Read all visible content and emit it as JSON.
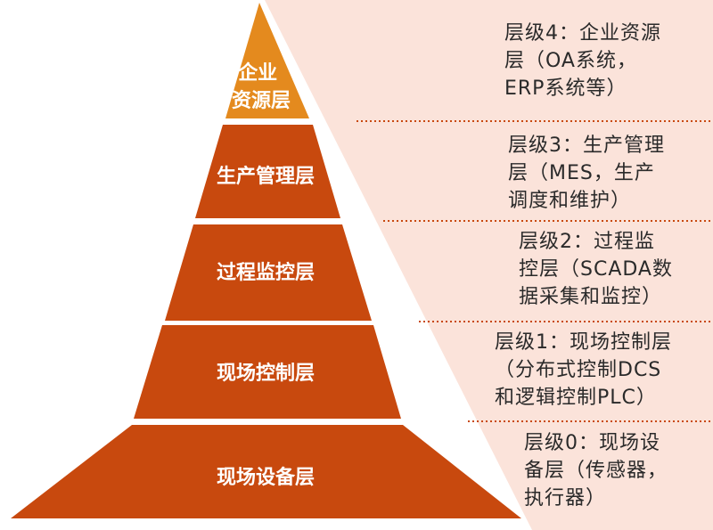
{
  "colors": {
    "top_level": "#E48A1E",
    "lower_levels": "#C8490E",
    "label_text": "#FFFFFF",
    "right_panel": "#FBE3DA",
    "divider": "#C8490E",
    "description_text": "#2A2A2A"
  },
  "levels": [
    {
      "pyramid_label": [
        "企业",
        "资源层"
      ],
      "description": [
        "层级4：企业资源",
        "层（OA系统，",
        "ERP系统等）"
      ]
    },
    {
      "pyramid_label": [
        "生产管理层"
      ],
      "description": [
        "层级3：生产管理",
        "层（MES，生产",
        "调度和维护）"
      ]
    },
    {
      "pyramid_label": [
        "过程监控层"
      ],
      "description": [
        "层级2：过程监",
        "控层（SCADA数",
        "据采集和监控）"
      ]
    },
    {
      "pyramid_label": [
        "现场控制层"
      ],
      "description": [
        "层级1：现场控制层",
        "（分布式控制DCS",
        "和逻辑控制PLC）"
      ]
    },
    {
      "pyramid_label": [
        "现场设备层"
      ],
      "description": [
        "层级0：现场设",
        "备层（传感器，",
        "执行器）"
      ]
    }
  ]
}
